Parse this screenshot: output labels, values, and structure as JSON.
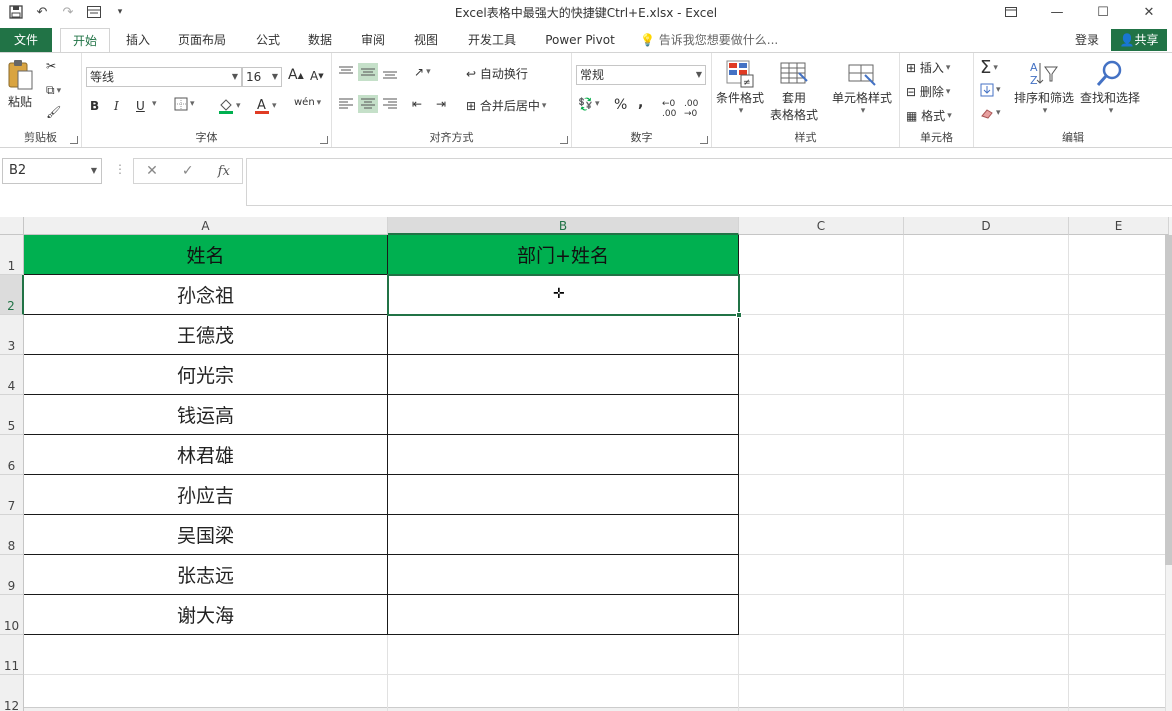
{
  "window": {
    "title": "Excel表格中最强大的快捷键Ctrl+E.xlsx - Excel"
  },
  "tabs": {
    "file": "文件",
    "home": "开始",
    "insert": "插入",
    "page_layout": "页面布局",
    "formulas": "公式",
    "data": "数据",
    "review": "审阅",
    "view": "视图",
    "developer": "开发工具",
    "power_pivot": "Power Pivot",
    "tell_me": "告诉我您想要做什么...",
    "login": "登录",
    "share": "共享"
  },
  "ribbon": {
    "clipboard": {
      "label": "剪贴板",
      "paste": "粘贴"
    },
    "font": {
      "label": "字体",
      "name": "等线",
      "size": "16",
      "bold": "B",
      "italic": "I",
      "underline": "U"
    },
    "alignment": {
      "label": "对齐方式",
      "wrap": "自动换行",
      "merge": "合并后居中"
    },
    "number": {
      "label": "数字",
      "format": "常规",
      "percent": "%",
      "comma": ","
    },
    "styles": {
      "label": "样式",
      "conditional": "条件格式",
      "table_line1": "套用",
      "table_line2": "表格格式",
      "cell_styles": "单元格样式"
    },
    "cells": {
      "label": "单元格",
      "insert": "插入",
      "delete": "删除",
      "format": "格式"
    },
    "editing": {
      "label": "编辑",
      "sort": "排序和筛选",
      "find": "查找和选择"
    }
  },
  "formula_bar": {
    "name_box": "B2",
    "cancel": "✕",
    "enter": "✓",
    "fx": "fx",
    "value": ""
  },
  "sheet": {
    "columns": [
      "A",
      "B",
      "C",
      "D",
      "E"
    ],
    "rows": [
      "1",
      "2",
      "3",
      "4",
      "5",
      "6",
      "7",
      "8",
      "9",
      "10",
      "11",
      "12"
    ],
    "header": {
      "a": "姓名",
      "b": "部门+姓名"
    },
    "names": [
      "孙念祖",
      "王德茂",
      "何光宗",
      "钱运高",
      "林君雄",
      "孙应吉",
      "吴国梁",
      "张志远",
      "谢大海"
    ],
    "selected_cell": "B2",
    "header_fill": "#00b050",
    "accent": "#217346"
  }
}
